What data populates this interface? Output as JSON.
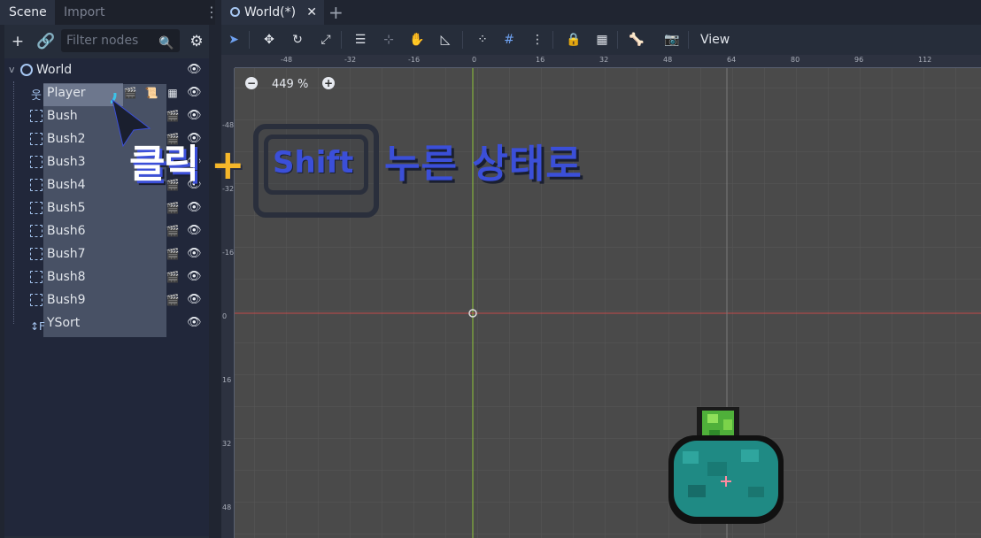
{
  "dock": {
    "tabs": [
      {
        "label": "Scene"
      },
      {
        "label": "Import"
      }
    ],
    "filter_placeholder": "Filter nodes",
    "tree": [
      {
        "label": "World"
      },
      {
        "label": "Player"
      },
      {
        "label": "Bush"
      },
      {
        "label": "Bush2"
      },
      {
        "label": "Bush3"
      },
      {
        "label": "Bush4"
      },
      {
        "label": "Bush5"
      },
      {
        "label": "Bush6"
      },
      {
        "label": "Bush7"
      },
      {
        "label": "Bush8"
      },
      {
        "label": "Bush9"
      },
      {
        "label": "YSort"
      }
    ]
  },
  "main": {
    "tab_label": "World(*)",
    "view_label": "View",
    "zoom_label": "449 %"
  },
  "rulers": {
    "top": [
      "-48",
      "-32",
      "-16",
      "0",
      "16",
      "32",
      "48",
      "64",
      "80",
      "96",
      "112"
    ],
    "left": [
      "-48",
      "-32",
      "-16",
      "0",
      "16",
      "32",
      "48"
    ]
  },
  "annotation": {
    "click": "클릭",
    "plus": "+",
    "key": "Shift",
    "press": "누른 상태로"
  },
  "colors": {
    "accent": "#3b4fd8",
    "plus": "#f5b72a",
    "x_axis": "#c24a4a",
    "y_axis": "#8fc43a"
  }
}
